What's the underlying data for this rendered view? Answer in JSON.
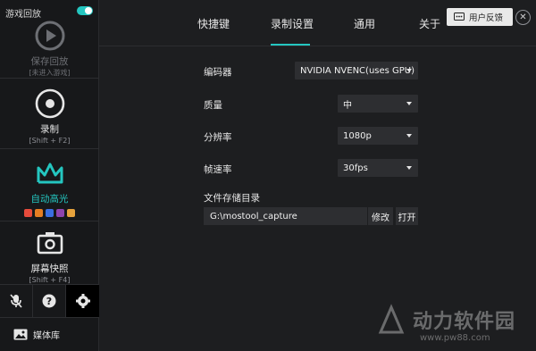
{
  "sidebar": {
    "game_replay_label": "游戏回放",
    "replay": {
      "title": "保存回放",
      "sub": "[未进入游戏]"
    },
    "record": {
      "title": "录制",
      "sub": "[Shift + F2]"
    },
    "auto_highlight": {
      "title": "自动高光",
      "mini_colors": [
        "#e64b3c",
        "#e67e22",
        "#3b6fe0",
        "#8e44ad",
        "#e6a23c"
      ]
    },
    "screenshot": {
      "title": "屏幕快照",
      "sub": "[Shift + F4]"
    },
    "media_library": "媒体库"
  },
  "tabs": [
    "快捷键",
    "录制设置",
    "通用",
    "关于"
  ],
  "active_tab": "录制设置",
  "feedback_label": "用户反馈",
  "settings": {
    "encoder": {
      "label": "编码器",
      "value": "NVIDIA NVENC(uses GPU)"
    },
    "quality": {
      "label": "质量",
      "value": "中"
    },
    "resolution": {
      "label": "分辨率",
      "value": "1080p"
    },
    "framerate": {
      "label": "帧速率",
      "value": "30fps"
    },
    "storage": {
      "label": "文件存储目录",
      "path": "G:\\mostool_capture",
      "modify_label": "修改",
      "open_label": "打开"
    }
  },
  "watermark": {
    "text": "动力软件园",
    "url": "www.pw88.com"
  },
  "colors": {
    "accent": "#24c6c0",
    "background": "#1d1e20",
    "sidebar": "#17181a"
  }
}
